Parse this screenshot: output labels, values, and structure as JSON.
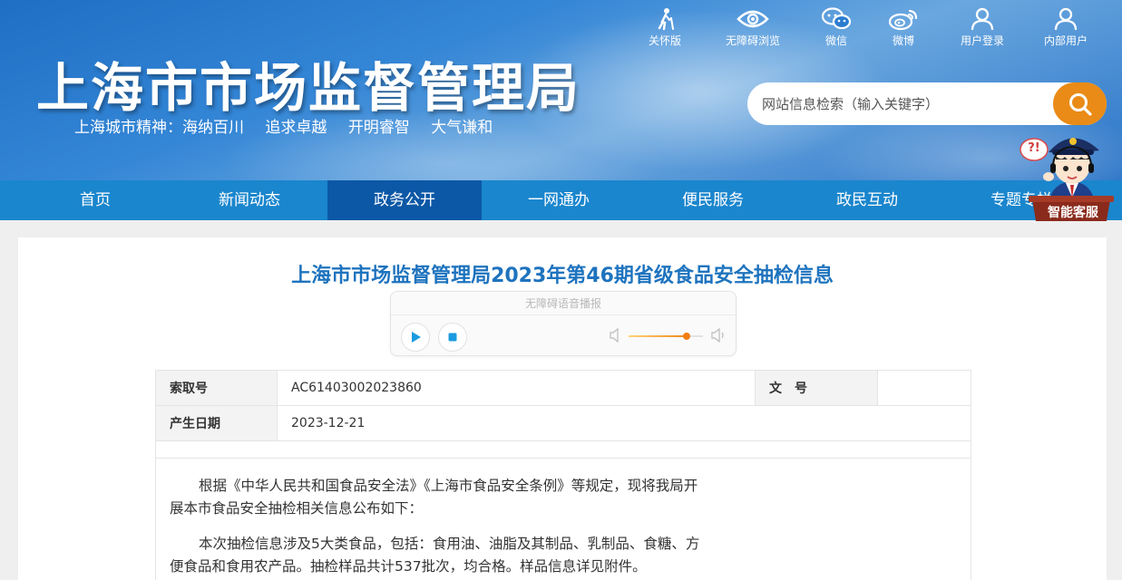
{
  "header": {
    "site_title": "上海市市场监督管理局",
    "spirit": [
      "上海城市精神：海纳百川",
      "追求卓越",
      "开明睿智",
      "大气谦和"
    ],
    "tools": [
      {
        "label": "关怀版",
        "icon": "elderly-care-icon"
      },
      {
        "label": "无障碍浏览",
        "icon": "eye-icon"
      },
      {
        "label": "微信",
        "icon": "wechat-icon"
      },
      {
        "label": "微博",
        "icon": "weibo-icon"
      },
      {
        "label": "用户登录",
        "icon": "user-icon"
      },
      {
        "label": "内部用户",
        "icon": "user-icon"
      }
    ],
    "search": {
      "placeholder": "网站信息检索（输入关键字）",
      "icon": "search-icon"
    },
    "accent_color": "#e98b16"
  },
  "nav": {
    "items": [
      "首页",
      "新闻动态",
      "政务公开",
      "一网通办",
      "便民服务",
      "政民互动",
      "专题专栏"
    ],
    "active": "政务公开",
    "color": "#1a86cd",
    "active_color": "#0c58a6"
  },
  "mascot": {
    "label": "智能客服",
    "bubble": "?!"
  },
  "article": {
    "title": "上海市市场监督管理局2023年第46期省级食品安全抽检信息",
    "player": {
      "title": "无障碍语音播报",
      "volume_level": 0.78
    },
    "meta": {
      "index_label": "索取号",
      "index_value": "AC61403002023860",
      "doc_label": "文　号",
      "doc_value": "",
      "date_label": "产生日期",
      "date_value": "2023-12-21"
    },
    "paragraphs": [
      "根据《中华人民共和国食品安全法》《上海市食品安全条例》等规定，现将我局开展本市食品安全抽检相关信息公布如下：",
      "本次抽检信息涉及5大类食品，包括：食用油、油脂及其制品、乳制品、食糖、方便食品和食用农产品。抽检样品共计537批次，均合格。样品信息详见附件。"
    ],
    "title_color": "#1e73be"
  }
}
